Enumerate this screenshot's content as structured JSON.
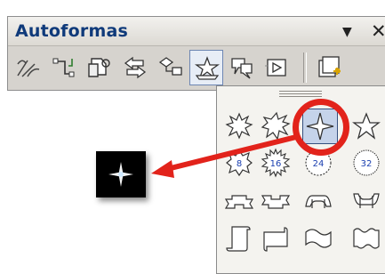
{
  "window": {
    "title": "Autoformas",
    "dropdown_glyph": "▼",
    "close_glyph": "✕"
  },
  "toolbar": {
    "buttons": [
      {
        "name": "lines-icon"
      },
      {
        "name": "connectors-icon"
      },
      {
        "name": "basic-shapes-icon"
      },
      {
        "name": "block-arrows-icon"
      },
      {
        "name": "flowchart-icon"
      },
      {
        "name": "stars-and-banners-icon",
        "active": true
      },
      {
        "name": "callouts-icon"
      },
      {
        "name": "action-buttons-icon"
      },
      {
        "name": "more-autoshapes-icon"
      }
    ]
  },
  "palette": {
    "grip": "drag-handle",
    "shapes": [
      {
        "name": "explosion-1-icon"
      },
      {
        "name": "explosion-2-icon"
      },
      {
        "name": "4-point-star-icon",
        "selected": true
      },
      {
        "name": "5-point-star-icon"
      },
      {
        "name": "8-point-star-icon",
        "label": "8"
      },
      {
        "name": "16-point-star-icon",
        "label": "16"
      },
      {
        "name": "24-point-star-icon",
        "label": "24"
      },
      {
        "name": "32-point-star-icon",
        "label": "32"
      },
      {
        "name": "up-ribbon-icon"
      },
      {
        "name": "down-ribbon-icon"
      },
      {
        "name": "curved-up-ribbon-icon"
      },
      {
        "name": "curved-down-ribbon-icon"
      },
      {
        "name": "vertical-scroll-icon"
      },
      {
        "name": "horizontal-scroll-icon"
      },
      {
        "name": "wave-icon"
      },
      {
        "name": "double-wave-icon"
      }
    ]
  },
  "annotation": {
    "highlight_color": "#e2231b",
    "arrow_color": "#e2231b"
  },
  "preview": {
    "background": "#000000",
    "shape": "4-point-star-icon"
  }
}
